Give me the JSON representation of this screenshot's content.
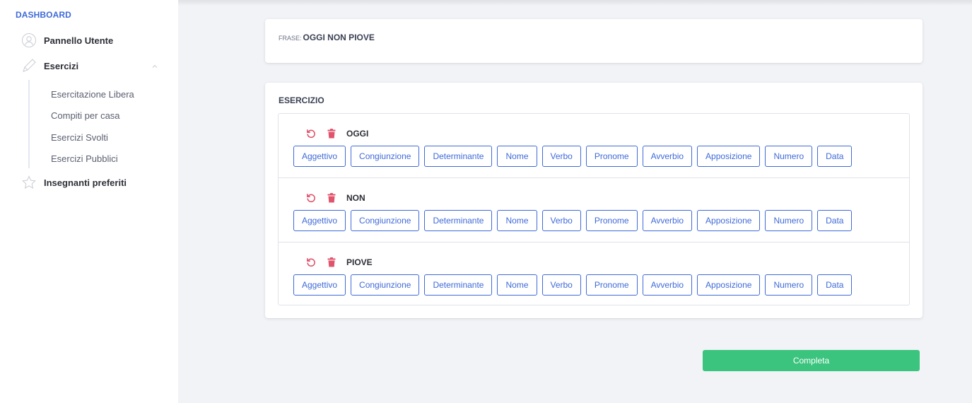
{
  "sidebar": {
    "heading": "DASHBOARD",
    "items": [
      {
        "label": "Pannello Utente",
        "icon": "user-icon"
      },
      {
        "label": "Esercizi",
        "icon": "pencil-icon"
      },
      {
        "label": "Insegnanti preferiti",
        "icon": "star-icon"
      }
    ],
    "subitems": [
      {
        "label": "Esercitazione Libera"
      },
      {
        "label": "Compiti per casa"
      },
      {
        "label": "Esercizi Svolti"
      },
      {
        "label": "Esercizi Pubblici"
      }
    ]
  },
  "frase": {
    "label": "FRASE:",
    "text": "OGGI NON PIOVE"
  },
  "esercizio": {
    "title": "ESERCIZIO",
    "parts_of_speech": [
      "Aggettivo",
      "Congiunzione",
      "Determinante",
      "Nome",
      "Verbo",
      "Pronome",
      "Avverbio",
      "Apposizione",
      "Numero",
      "Data"
    ],
    "words": [
      {
        "word": "OGGI"
      },
      {
        "word": "NON"
      },
      {
        "word": "PIOVE"
      }
    ]
  },
  "actions": {
    "complete_label": "Completa"
  },
  "colors": {
    "accent": "#3f6ad8",
    "success": "#3ac47d",
    "danger": "#d92550",
    "background": "#f1f3f7"
  }
}
